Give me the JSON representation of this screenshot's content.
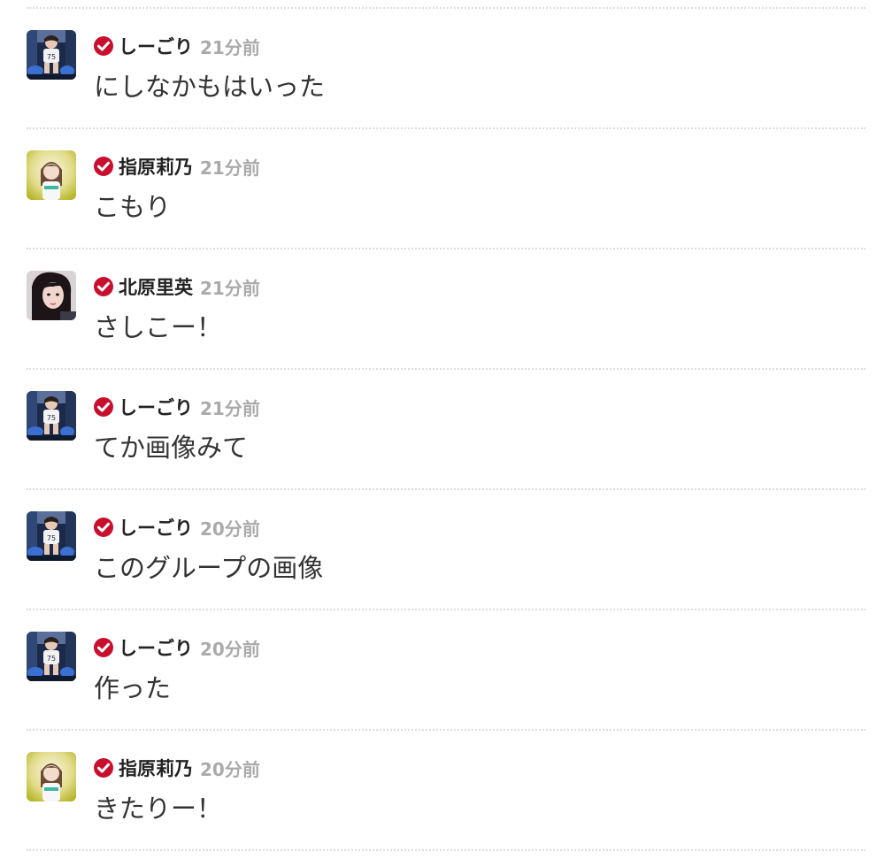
{
  "colors": {
    "badge": "#c8102e",
    "time": "#aaaaaa",
    "name": "#222222",
    "message": "#333333",
    "separator": "#dddddd"
  },
  "badge_icon": "verified-check-icon",
  "comments": [
    {
      "user": "しーごり",
      "avatar": "shigori-avatar",
      "time": "21分前",
      "message": "にしなかもはいった"
    },
    {
      "user": "指原莉乃",
      "avatar": "sashihara-avatar",
      "time": "21分前",
      "message": "こもり"
    },
    {
      "user": "北原里英",
      "avatar": "kitahara-avatar",
      "time": "21分前",
      "message": "さしこー！"
    },
    {
      "user": "しーごり",
      "avatar": "shigori-avatar",
      "time": "21分前",
      "message": "てか画像みて"
    },
    {
      "user": "しーごり",
      "avatar": "shigori-avatar",
      "time": "20分前",
      "message": "このグループの画像"
    },
    {
      "user": "しーごり",
      "avatar": "shigori-avatar",
      "time": "20分前",
      "message": "作った"
    },
    {
      "user": "指原莉乃",
      "avatar": "sashihara-avatar",
      "time": "20分前",
      "message": "きたりー！"
    }
  ]
}
